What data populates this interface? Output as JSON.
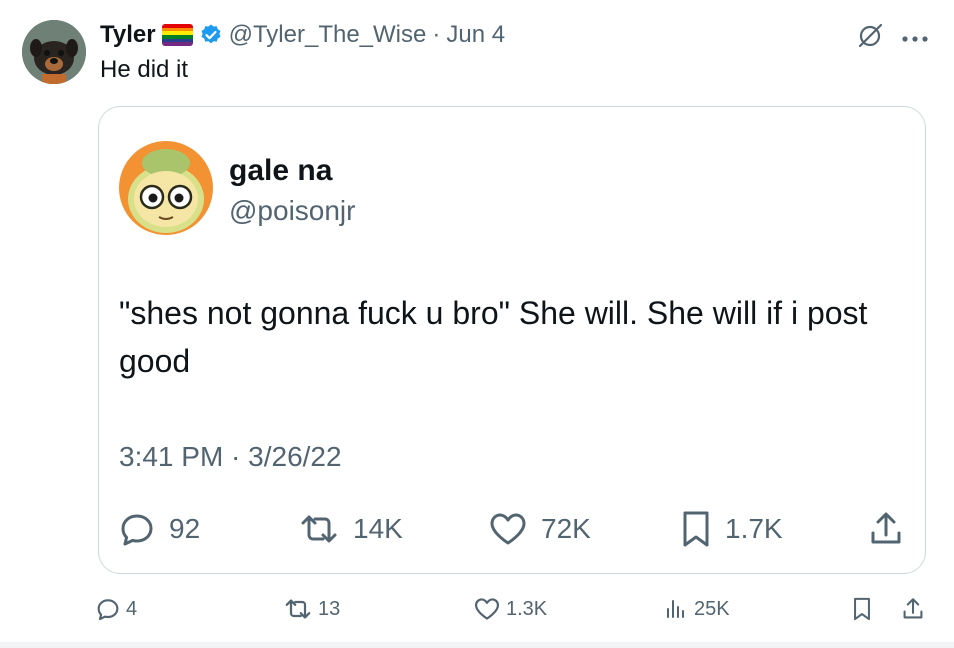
{
  "tweet": {
    "author_name": "Tyler",
    "author_handle": "@Tyler_The_Wise",
    "separator": "·",
    "date": "Jun 4",
    "text": "He did it",
    "flag_icon": "rainbow-flag-icon",
    "verified_icon": "verified-badge-icon"
  },
  "quoted": {
    "author_name": "gale na",
    "author_handle": "@poisonjr",
    "text": "\"shes not gonna fuck u bro\" She will. She will if i post good",
    "timestamp": "3:41 PM · 3/26/22",
    "stats": {
      "replies": "92",
      "reposts": "14K",
      "likes": "72K",
      "bookmarks": "1.7K"
    }
  },
  "actions": {
    "replies": "4",
    "reposts": "13",
    "likes": "1.3K",
    "views": "25K"
  },
  "colors": {
    "text": "#0f1419",
    "secondary": "#536471",
    "verified": "#1d9bf0",
    "border": "#cfd9de"
  }
}
